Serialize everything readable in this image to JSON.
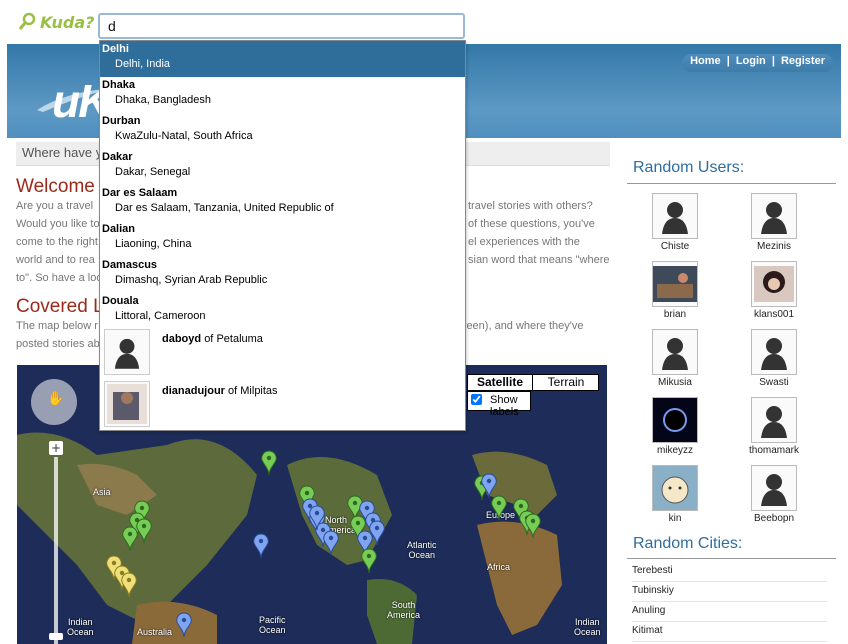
{
  "brand": {
    "name": "Kuda?"
  },
  "search": {
    "value": "d"
  },
  "nav": {
    "home": "Home",
    "sep": "|",
    "login": "Login",
    "register": "Register"
  },
  "logo": {
    "text": "uK"
  },
  "where": {
    "text": "Where have y"
  },
  "welcome": {
    "title": "Welcome t",
    "lines": [
      "Are you a travel ",
      "Would you like to",
      "come to the right",
      "world and to rea",
      "to\". So have a loo"
    ],
    "right_lines": [
      "travel stories with others?",
      "of these questions, you've",
      "el experiences with the",
      "sian word that means \"where",
      ""
    ]
  },
  "covered": {
    "title": "Covered Lo",
    "line1": "The map below r",
    "line1_right": "(green), and where they've",
    "line2": "posted stories ab"
  },
  "map": {
    "satellite": "Satellite",
    "terrain": "Terrain",
    "show_labels": "Show labels",
    "show_labels_checked": true,
    "labels": {
      "asia": "Asia",
      "north": "North",
      "america": "America",
      "europe": "Europe",
      "africa": "Africa",
      "atlantic": "Atlantic\nOcean",
      "pacific": "Pacific\nOcean",
      "south_america": "South\nAmerica",
      "indian": "Indian\nOcean",
      "australia": "Australia",
      "indian2": "Indian\nOcean"
    }
  },
  "sidebar": {
    "users_title": "Random Users:",
    "users": [
      {
        "name": "Chiste",
        "avatar": "silhouette"
      },
      {
        "name": "Mezinis",
        "avatar": "silhouette"
      },
      {
        "name": "brian",
        "avatar": "photo"
      },
      {
        "name": "klans001",
        "avatar": "photo"
      },
      {
        "name": "Mikusia",
        "avatar": "silhouette"
      },
      {
        "name": "Swasti",
        "avatar": "silhouette"
      },
      {
        "name": "mikeyzz",
        "avatar": "eclipse"
      },
      {
        "name": "thomamark",
        "avatar": "silhouette"
      },
      {
        "name": "kin",
        "avatar": "cartoon"
      },
      {
        "name": "Beebopn",
        "avatar": "silhouette"
      }
    ],
    "cities_title": "Random Cities:",
    "cities": [
      "Terebesti",
      "Tubinskiy",
      "Anuling",
      "Kitimat"
    ]
  },
  "dropdown": {
    "items": [
      {
        "title": "Delhi",
        "sub": "Delhi, India",
        "selected": true
      },
      {
        "title": "Dhaka",
        "sub": "Dhaka, Bangladesh"
      },
      {
        "title": "Durban",
        "sub": "KwaZulu-Natal, South Africa"
      },
      {
        "title": "Dakar",
        "sub": "Dakar, Senegal"
      },
      {
        "title": "Dar es Salaam",
        "sub": "Dar es Salaam, Tanzania, United Republic of"
      },
      {
        "title": "Dalian",
        "sub": "Liaoning, China"
      },
      {
        "title": "Damascus",
        "sub": "Dimashq, Syrian Arab Republic"
      },
      {
        "title": "Douala",
        "sub": "Littoral, Cameroon"
      }
    ],
    "users": [
      {
        "name": "daboyd",
        "of": "of",
        "place": "Petaluma"
      },
      {
        "name": "dianadujour",
        "of": "of",
        "place": "Milpitas"
      }
    ]
  },
  "colors": {
    "header": "#3f82b3",
    "title_red": "#9a2a1a",
    "side_blue": "#2e6d9e",
    "selected": "#2f6d9a",
    "brand_green": "#9bbf45"
  }
}
